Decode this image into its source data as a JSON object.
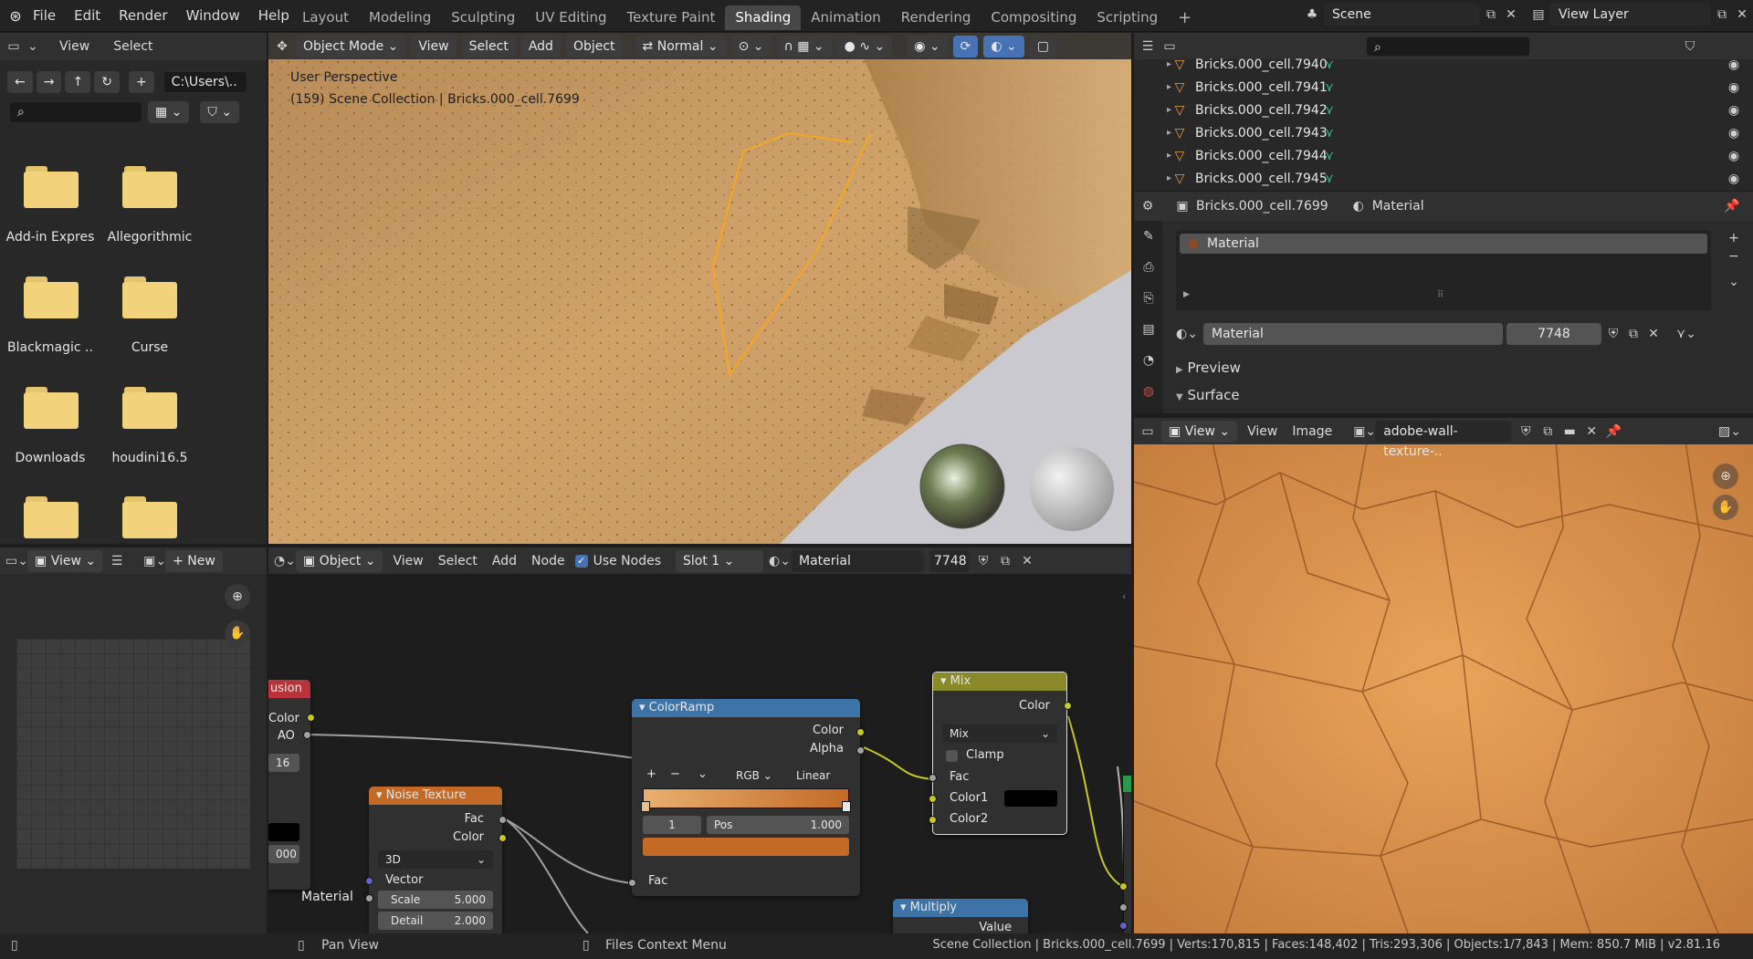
{
  "topbar": {
    "menus": [
      "File",
      "Edit",
      "Render",
      "Window",
      "Help"
    ],
    "workspaces": [
      "Layout",
      "Modeling",
      "Sculpting",
      "UV Editing",
      "Texture Paint",
      "Shading",
      "Animation",
      "Rendering",
      "Compositing",
      "Scripting"
    ],
    "active_workspace": "Shading",
    "add_tab": "+",
    "scene": "Scene",
    "view_layer": "View Layer"
  },
  "file_browser": {
    "header_items": [
      "View",
      "Select"
    ],
    "path": "C:\\Users\\..",
    "folders": [
      "Add-in Expres",
      "Allegorithmic",
      "Blackmagic ..",
      "Curse",
      "Downloads",
      "houdini16.5",
      "",
      ""
    ]
  },
  "viewport": {
    "mode": "Object Mode",
    "menus": [
      "View",
      "Select",
      "Add",
      "Object"
    ],
    "orientation": "Normal",
    "overlay_title": "User Perspective",
    "overlay_sub": "(159) Scene Collection | Bricks.000_cell.7699"
  },
  "outliner": {
    "rows": [
      "Bricks.000_cell.7940",
      "Bricks.000_cell.7941",
      "Bricks.000_cell.7942",
      "Bricks.000_cell.7943",
      "Bricks.000_cell.7944",
      "Bricks.000_cell.7945"
    ]
  },
  "properties": {
    "object": "Bricks.000_cell.7699",
    "tab": "Material",
    "slot": "Material",
    "material_name": "Material",
    "users": "7748",
    "sections": [
      "Preview",
      "Surface"
    ]
  },
  "image_editor": {
    "menus": [
      "View",
      "View",
      "Image"
    ],
    "image_name": "adobe-wall-texture-.."
  },
  "uv_panel": {
    "view": "View",
    "new_label": "New"
  },
  "node_editor": {
    "type": "Object",
    "menus": [
      "View",
      "Select",
      "Add",
      "Node"
    ],
    "use_nodes": "Use Nodes",
    "slot": "Slot 1",
    "material": "Material",
    "users": "7748",
    "ao_node": {
      "title": "usion",
      "out1": "Color",
      "out2": "AO",
      "samples": "16",
      "dist": "000"
    },
    "noise": {
      "title": "Noise Texture",
      "out1": "Fac",
      "out2": "Color",
      "dim": "3D",
      "in1": "Vector",
      "scale_label": "Scale",
      "scale_val": "5.000",
      "detail_label": "Detail",
      "detail_val": "2.000"
    },
    "colorramp": {
      "title": "ColorRamp",
      "out1": "Color",
      "out2": "Alpha",
      "mode": "RGB",
      "interp": "Linear",
      "index": "1",
      "pos_label": "Pos",
      "pos_val": "1.000",
      "in1": "Fac"
    },
    "mix": {
      "title": "Mix",
      "out1": "Color",
      "blend": "Mix",
      "clamp": "Clamp",
      "in1": "Fac",
      "in2": "Color1",
      "in3": "Color2"
    },
    "multiply": {
      "title": "Multiply",
      "out1": "Value"
    },
    "frame_label": "Material"
  },
  "status": {
    "pan": "Pan View",
    "context": "Files Context Menu",
    "stats": "Scene Collection | Bricks.000_cell.7699 | Verts:170,815 | Faces:148,402 | Tris:293,306 | Objects:1/7,843 | Mem: 850.7 MiB | v2.81.16"
  },
  "colors": {
    "accent": "#4772b3",
    "folder": "#f2d27a",
    "socket_yellow": "#c7c729",
    "socket_grey": "#a1a1a1",
    "socket_purple": "#6363c7",
    "colorramp_header": "#3e73a8",
    "mix_header": "#8a8a2a",
    "noise_header": "#c36a26",
    "ao_header": "#b8333c",
    "multiply_header": "#3e73a8",
    "selection_orange": "#f5a623"
  }
}
